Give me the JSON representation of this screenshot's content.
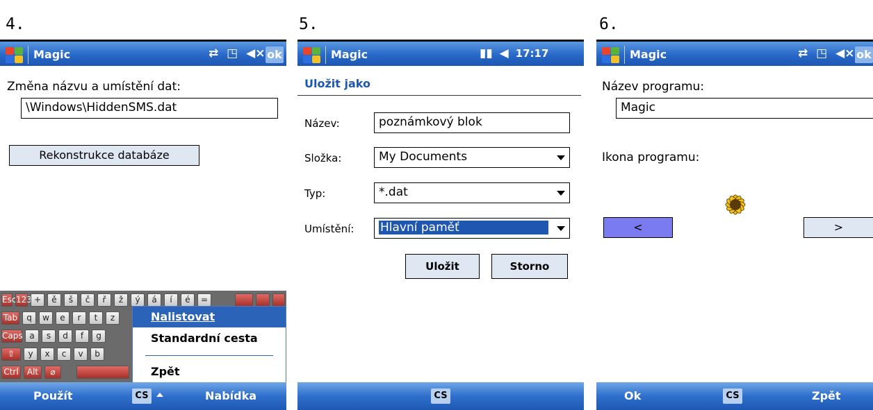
{
  "steps": [
    "4.",
    "5.",
    "6."
  ],
  "colors": {
    "titlebar": "#2868c8",
    "selected_bg": "#1e56b0",
    "menu_highlight": "#2b63b8",
    "prev_button": "#7b7bf0",
    "keyboard_red": "#c0403a"
  },
  "screen4": {
    "title": "Magic",
    "tray_icons": [
      "connectivity-icon",
      "notification-icon",
      "speaker-mute-icon"
    ],
    "ok_label": "ok",
    "rename_label": "Změna názvu a umístění dat:",
    "path_value": "\\Windows\\HiddenSMS.dat",
    "rebuild_button": "Rekonstrukce databáze",
    "keyboard": {
      "row1": [
        "Esc",
        "123",
        "+",
        "ě",
        "š",
        "č",
        "ř",
        "ž",
        "ý",
        "á",
        "í",
        "é",
        "="
      ],
      "row2": [
        "Tab",
        "q",
        "w",
        "e",
        "r",
        "t",
        "z"
      ],
      "row3": [
        "Caps",
        "a",
        "s",
        "d",
        "f",
        "g"
      ],
      "row4": [
        "⇧",
        "y",
        "x",
        "c",
        "v",
        "b"
      ],
      "row5": [
        "Ctrl",
        "Alt",
        "⌀"
      ]
    },
    "menu": {
      "item1": "Nalistovat",
      "item2": "Standardní cesta",
      "item3": "Zpět"
    },
    "bottom_left": "Použít",
    "input_lang": "CS",
    "bottom_right": "Nabídka"
  },
  "screen5": {
    "title": "Magic",
    "tray_icons": [
      "signal-icon",
      "speaker-icon"
    ],
    "time": "17:17",
    "heading": "Uložit jako",
    "name_label": "Název:",
    "name_value": "poznámkový blok",
    "folder_label": "Složka:",
    "folder_value": "My Documents",
    "type_label": "Typ:",
    "type_value": "*.dat",
    "location_label": "Umístění:",
    "location_value": "Hlavní paměť",
    "save_button": "Uložit",
    "cancel_button": "Storno",
    "input_lang": "CS"
  },
  "screen6": {
    "title": "Magic",
    "tray_icons": [
      "connectivity-icon",
      "notification-icon",
      "speaker-mute-icon"
    ],
    "ok_label": "ok",
    "program_name_label": "Název programu:",
    "program_name_value": "Magic",
    "program_icon_label": "Ikona programu:",
    "prev_label": "<",
    "next_label": ">",
    "bottom_left": "Ok",
    "input_lang": "CS",
    "bottom_right": "Zpět"
  }
}
